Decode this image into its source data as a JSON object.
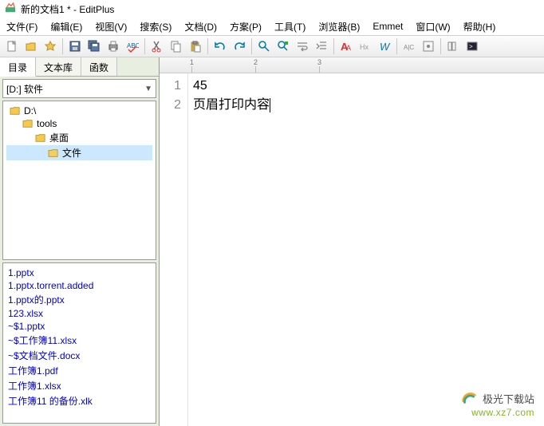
{
  "window": {
    "title": "新的文档1 * - EditPlus"
  },
  "menu": {
    "file": "文件(F)",
    "edit": "编辑(E)",
    "view": "视图(V)",
    "search": "搜索(S)",
    "doc": "文档(D)",
    "plan": "方案(P)",
    "tools": "工具(T)",
    "browser": "浏览器(B)",
    "emmet": "Emmet",
    "window": "窗口(W)",
    "help": "帮助(H)"
  },
  "sidebar": {
    "tabs": {
      "dir": "目录",
      "lib": "文本库",
      "fn": "函数"
    },
    "drive": "[D:] 软件",
    "tree": [
      {
        "label": "D:\\",
        "level": 1
      },
      {
        "label": "tools",
        "level": 2
      },
      {
        "label": "桌面",
        "level": 3
      },
      {
        "label": "文件",
        "level": 4,
        "selected": true
      }
    ],
    "files": [
      "1.pptx",
      "1.pptx.torrent.added",
      "1.pptx的.pptx",
      "123.xlsx",
      "~$1.pptx",
      "~$工作簿11.xlsx",
      "~$文档文件.docx",
      "工作簿1.pdf",
      "工作簿1.xlsx",
      "工作簿11 的备份.xlk"
    ]
  },
  "editor": {
    "lines": [
      "45",
      "页眉打印内容"
    ],
    "lineNumbers": [
      "1",
      "2"
    ]
  },
  "ruler": [
    "1",
    "2",
    "3"
  ],
  "watermark": {
    "name": "极光下载站",
    "url": "www.xz7.com"
  }
}
